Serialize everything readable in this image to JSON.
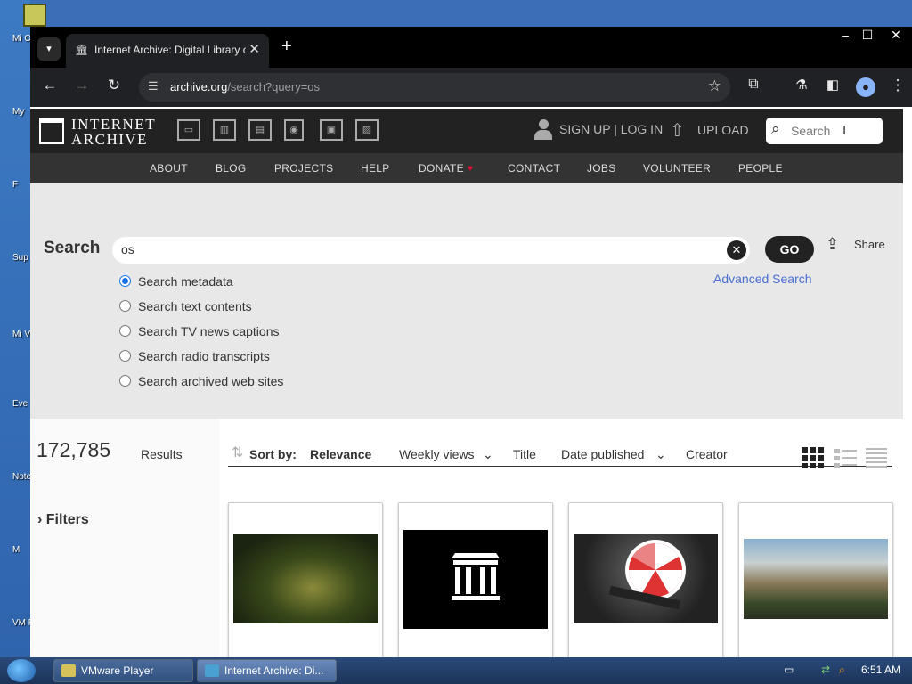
{
  "desktop": {
    "icons": [
      "Mi O",
      "My",
      "F",
      "Sup",
      "Mi Visu",
      "Eve",
      "Note",
      "M",
      "VM P"
    ]
  },
  "browser": {
    "tab_title": "Internet Archive: Digital Library of Free & Borrowable Books, Movies, Music & Wayback Machine",
    "url_domain": "archive.org",
    "url_path": "/search?query=os",
    "window_controls": [
      "–",
      "☐",
      "✕"
    ]
  },
  "ia_header": {
    "logo_line1": "INTERNET",
    "logo_line2": "ARCHIVE",
    "media_icons": [
      "web-icon",
      "texts-icon",
      "video-icon",
      "audio-icon",
      "software-icon",
      "images-icon"
    ],
    "signup": "SIGN UP | LOG IN",
    "upload": "UPLOAD",
    "search_placeholder": "Search"
  },
  "nav": {
    "items": [
      "ABOUT",
      "BLOG",
      "PROJECTS",
      "HELP",
      "DONATE",
      "CONTACT",
      "JOBS",
      "VOLUNTEER",
      "PEOPLE"
    ]
  },
  "search_panel": {
    "label": "Search",
    "query": "os",
    "go": "GO",
    "share": "Share",
    "advanced": "Advanced Search",
    "options": [
      {
        "label": "Search metadata",
        "checked": true
      },
      {
        "label": "Search text contents",
        "checked": false
      },
      {
        "label": "Search TV news captions",
        "checked": false
      },
      {
        "label": "Search radio transcripts",
        "checked": false
      },
      {
        "label": "Search archived web sites",
        "checked": false
      }
    ]
  },
  "results": {
    "count": "172,785",
    "count_label": "Results",
    "filters": "Filters",
    "sort_label": "Sort by:",
    "sort_options": [
      "Relevance",
      "Weekly views",
      "Title",
      "Date published",
      "Creator"
    ],
    "active_sort": "Relevance",
    "view_modes": [
      "tile-view-icon",
      "list-view-icon",
      "compact-list-icon"
    ],
    "cards": [
      "forest-path-thumbnail",
      "archive-logo-thumbnail",
      "peppermint-os-thumbnail",
      "mountain-valley-thumbnail"
    ]
  },
  "taskbar": {
    "tasks": [
      "VMware Player",
      "Internet Archive: Di..."
    ],
    "clock": "6:51 AM"
  }
}
